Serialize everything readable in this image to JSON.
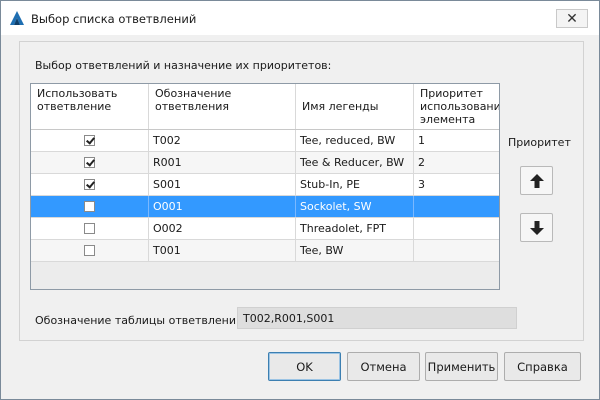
{
  "window": {
    "title": "Выбор списка ответвлений",
    "close_glyph": "✕"
  },
  "group": {
    "label": "Выбор ответвлений и назначение их приоритетов:"
  },
  "grid": {
    "headers": [
      "Использовать ответвление",
      "Обозначение ответвления",
      "Имя легенды",
      "Приоритет использования элемента"
    ],
    "rows": [
      {
        "checked": true,
        "code": "T002",
        "legend": "Tee, reduced, BW",
        "priority": "1",
        "selected": false
      },
      {
        "checked": true,
        "code": "R001",
        "legend": "Tee & Reducer, BW",
        "priority": "2",
        "selected": false
      },
      {
        "checked": true,
        "code": "S001",
        "legend": "Stub-In, PE",
        "priority": "3",
        "selected": false
      },
      {
        "checked": false,
        "code": "O001",
        "legend": "Sockolet, SW",
        "priority": "",
        "selected": true
      },
      {
        "checked": false,
        "code": "O002",
        "legend": "Threadolet, FPT",
        "priority": "",
        "selected": false
      },
      {
        "checked": false,
        "code": "T001",
        "legend": "Tee, BW",
        "priority": "",
        "selected": false
      }
    ]
  },
  "priority": {
    "label": "Приоритет",
    "up_icon": "arrow-up-icon",
    "down_icon": "arrow-down-icon"
  },
  "branch_table": {
    "label": "Обозначение таблицы ответвлений:",
    "value": "T002,R001,S001"
  },
  "buttons": {
    "ok": "OK",
    "cancel": "Отмена",
    "apply": "Применить",
    "help": "Справка"
  },
  "colors": {
    "selection": "#3399ff",
    "accent": "#1f6fb2"
  }
}
